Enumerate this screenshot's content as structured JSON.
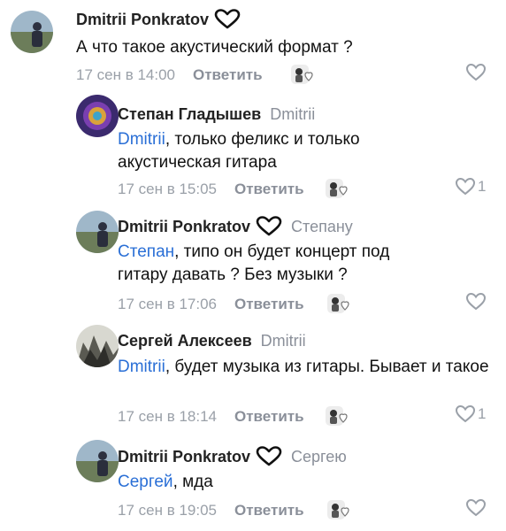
{
  "comments": [
    {
      "author": "Dmitrii Ponkratov",
      "reply_to": "",
      "mention": "",
      "text": "А что такое акустический формат ?",
      "date": "17 сен в 14:00",
      "reply_label": "Ответить",
      "likes": ""
    },
    {
      "author": "Степан Гладышев",
      "reply_to": "Dmitrii",
      "mention": "Dmitrii",
      "text": ", только феликс и только акустическая гитара",
      "date": "17 сен в 15:05",
      "reply_label": "Ответить",
      "likes": "1"
    },
    {
      "author": "Dmitrii Ponkratov",
      "reply_to": "Степану",
      "mention": "Степан",
      "text": ", типо он будет концерт под гитару давать ? Без музыки ?",
      "date": "17 сен в 17:06",
      "reply_label": "Ответить",
      "likes": ""
    },
    {
      "author": "Сергей Алексеев",
      "reply_to": "Dmitrii",
      "mention": "Dmitrii",
      "text": ", будет музыка из гитары. Бывает и такое",
      "date": "17 сен в 18:14",
      "reply_label": "Ответить",
      "likes": "1"
    },
    {
      "author": "Dmitrii Ponkratov",
      "reply_to": "Сергею",
      "mention": "Сергей",
      "text": ", мда",
      "date": "17 сен в 19:05",
      "reply_label": "Ответить",
      "likes": ""
    }
  ],
  "icons": {
    "badge": "heart-outline-icon",
    "like": "heart-outline-icon",
    "reaction": "sticker-icon"
  },
  "colors": {
    "mention": "#2a6fd6",
    "muted": "#9aa0a8",
    "author": "#222222"
  }
}
